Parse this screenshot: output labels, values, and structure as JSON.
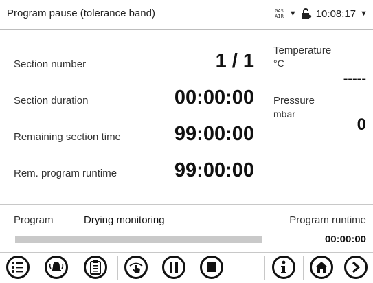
{
  "header": {
    "title": "Program pause (tolerance band)",
    "gas_air_top": "GAS",
    "gas_air_bottom": "AIR",
    "clock": "10:08:17"
  },
  "main": {
    "rows": [
      {
        "label": "Section number",
        "value": "1 / 1"
      },
      {
        "label": "Section duration",
        "value": "00:00:00"
      },
      {
        "label": "Remaining section time",
        "value": "99:00:00"
      },
      {
        "label": "Rem. program runtime",
        "value": "99:00:00"
      }
    ],
    "side": {
      "temperature_label": "Temperature",
      "temperature_unit": "°C",
      "temperature_value": "-----",
      "pressure_label": "Pressure",
      "pressure_unit": "mbar",
      "pressure_value": "0"
    }
  },
  "program": {
    "label": "Program",
    "name": "Drying monitoring",
    "runtime_label": "Program runtime",
    "runtime_value": "00:00:00",
    "progress_fraction": 0.0
  },
  "toolbar": {
    "icons": [
      "menu-icon",
      "alarm-bell-icon",
      "clipboard-list-icon",
      "touch-hand-icon",
      "pause-icon",
      "stop-icon",
      "info-icon",
      "home-icon",
      "next-arrow-icon"
    ]
  }
}
